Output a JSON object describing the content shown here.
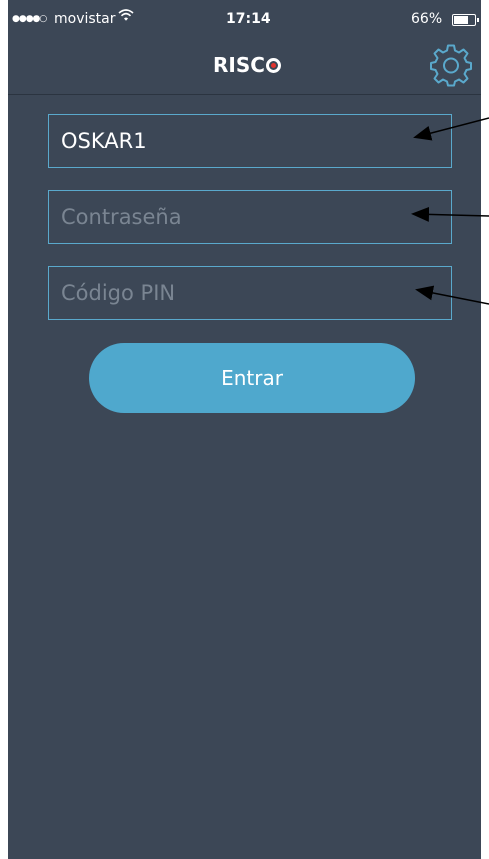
{
  "status_bar": {
    "signal": "●●●●○",
    "carrier": "movistar",
    "wifi": "wifi-icon",
    "time": "17:14",
    "battery": "66%"
  },
  "nav": {
    "logo_text": "RISC",
    "settings_icon": "gear-icon"
  },
  "form": {
    "username_value": "OSKAR1",
    "password_placeholder": "Contraseña",
    "pin_placeholder": "Código PIN",
    "submit_label": "Entrar"
  },
  "colors": {
    "background": "#3c4756",
    "accent": "#4fa8cd",
    "field_border": "#5aa9cc",
    "logo_dot": "#e2342f"
  }
}
